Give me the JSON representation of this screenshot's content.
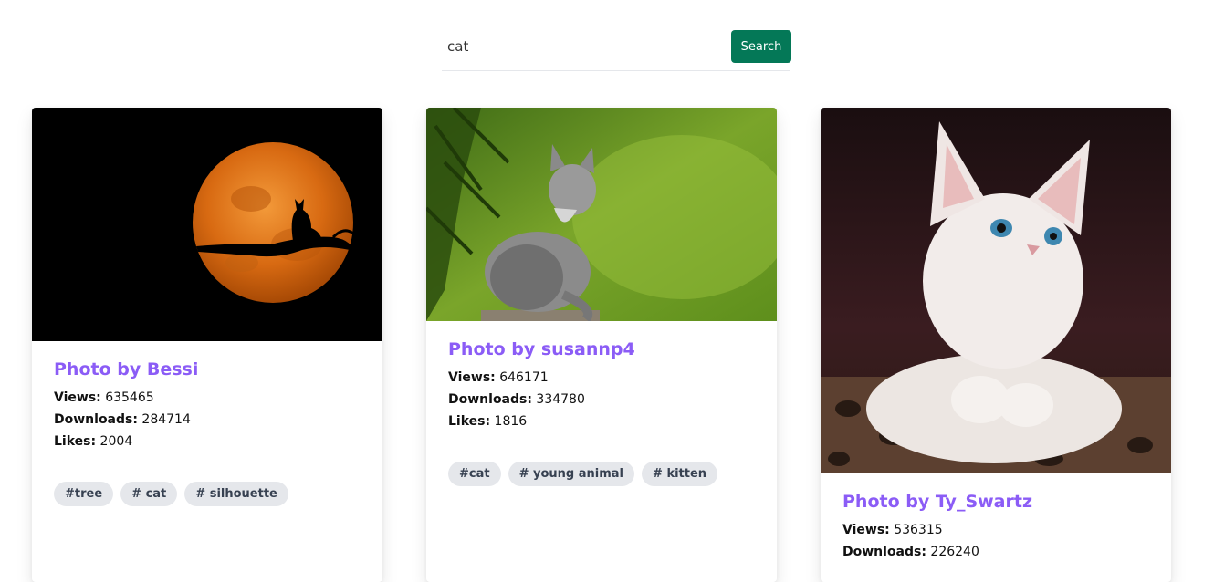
{
  "search": {
    "value": "cat",
    "button_label": "Search"
  },
  "labels": {
    "views": "Views:",
    "downloads": "Downloads:",
    "likes": "Likes:"
  },
  "cards": [
    {
      "title": "Photo by Bessi",
      "views": "635465",
      "downloads": "284714",
      "likes": "2004",
      "tags": [
        "#tree",
        "# cat",
        "# silhouette"
      ]
    },
    {
      "title": "Photo by susannp4",
      "views": "646171",
      "downloads": "334780",
      "likes": "1816",
      "tags": [
        "#cat",
        "# young animal",
        "# kitten"
      ]
    },
    {
      "title": "Photo by Ty_Swartz",
      "views": "536315",
      "downloads": "226240",
      "likes": "",
      "tags": []
    }
  ],
  "colors": {
    "accent_title": "#8b5cf6",
    "button": "#047857",
    "tag_bg": "#e5e7eb"
  }
}
